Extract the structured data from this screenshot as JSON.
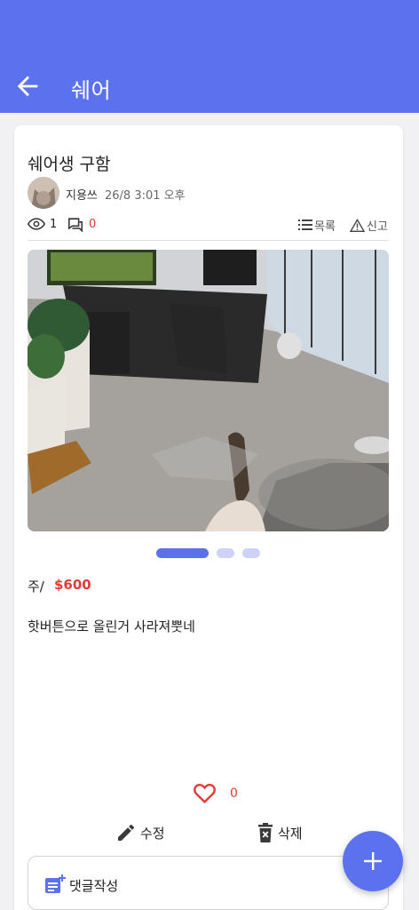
{
  "appbar": {
    "title": "쉐어"
  },
  "post": {
    "title": "쉐어생 구함",
    "author": "지용쓰",
    "date": "26/8 3:01 오후",
    "views": "1",
    "comments": "0",
    "list_label": "목록",
    "report_label": "신고",
    "price_unit": "주/",
    "price": "$600",
    "content": "핫버튼으로 올린거 사라져뿟네",
    "likes": "0",
    "image_count": 3,
    "current_image": 1
  },
  "actions": {
    "edit_label": "수정",
    "delete_label": "삭제"
  },
  "comment_box": {
    "label": "댓글작성"
  },
  "colors": {
    "accent": "#5b71ee",
    "red": "#e53935",
    "dot_inactive": "#cfd2f8"
  },
  "icons": [
    "back-arrow-icon",
    "eye-icon",
    "comment-icon",
    "list-icon",
    "warning-icon",
    "heart-icon",
    "pencil-icon",
    "trash-icon",
    "note-add-icon",
    "plus-icon"
  ]
}
